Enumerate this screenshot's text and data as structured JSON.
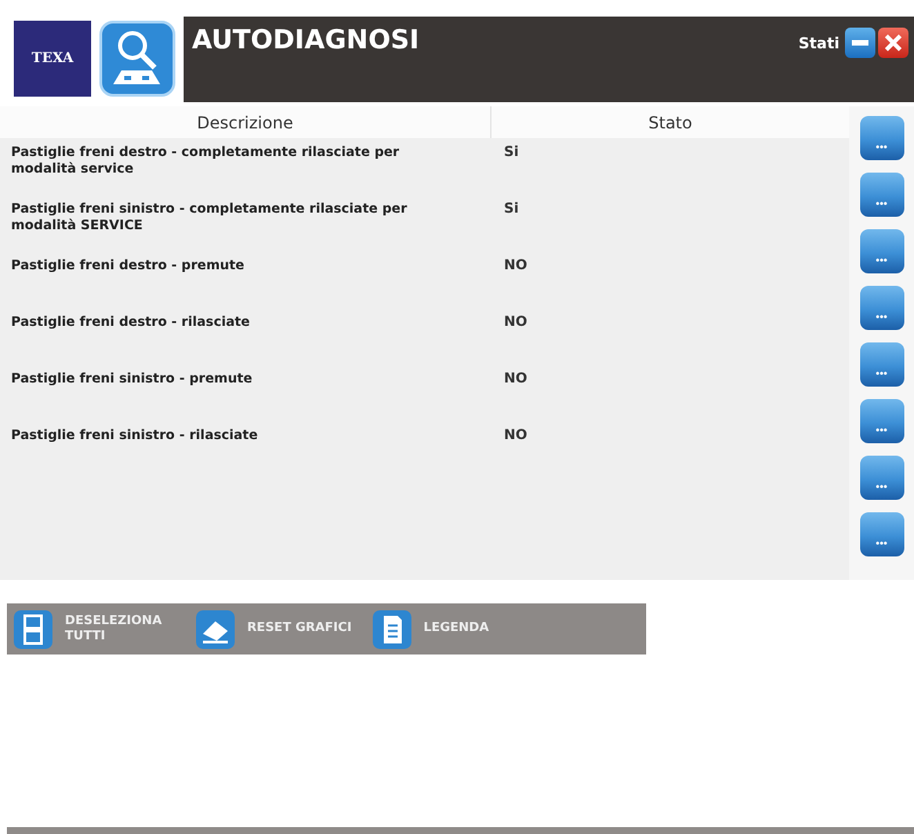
{
  "logo": "TEXA",
  "title": "AUTODIAGNOSI",
  "status_label": "Stati",
  "table": {
    "columns": [
      "Descrizione",
      "Stato"
    ],
    "rows": [
      {
        "description": "Pastiglie freni destro - completamente rilasciate per modalità service",
        "state": "Si"
      },
      {
        "description": "Pastiglie freni sinistro - completamente rilasciate per modalità SERVICE",
        "state": "Si"
      },
      {
        "description": "Pastiglie freni destro - premute",
        "state": "NO"
      },
      {
        "description": "Pastiglie freni destro - rilasciate",
        "state": "NO"
      },
      {
        "description": "Pastiglie freni sinistro - premute",
        "state": "NO"
      },
      {
        "description": "Pastiglie freni sinistro - rilasciate",
        "state": "NO"
      }
    ]
  },
  "side_buttons": [
    "•••",
    "•••",
    "•••",
    "•••",
    "•••",
    "•••",
    "•••",
    "•••"
  ],
  "toolbar": [
    {
      "kind": "deselect",
      "label": "DESELEZIONA TUTTI"
    },
    {
      "kind": "reset",
      "label": "RESET GRAFICI"
    },
    {
      "kind": "legend",
      "label": "LEGENDA"
    }
  ]
}
